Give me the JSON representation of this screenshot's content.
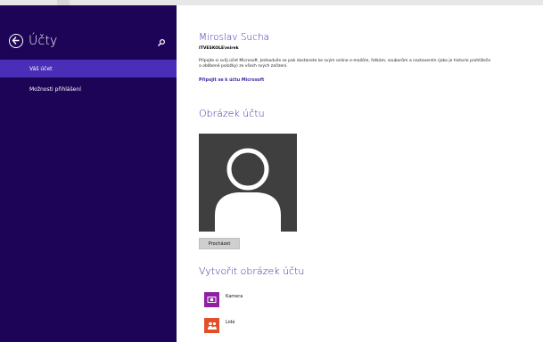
{
  "window": {
    "title": "Účty"
  },
  "sidebar": {
    "items": [
      {
        "label": "Váš účet",
        "selected": true
      },
      {
        "label": "Možnosti přihlášení",
        "selected": false
      }
    ]
  },
  "account": {
    "name": "Miroslav Sucha",
    "username": "ITVESKOLE\\mirek",
    "description": "Připojte si svůj účet Microsoft. Jednoduše se pak dostanete ke svým online e-mailům, fotkám, souborům a nastavením (jako je historie prohlížeče a oblíbené položky) ze všech svých zařízení.",
    "link": "Připojit se k účtu Microsoft"
  },
  "picture": {
    "heading": "Obrázek účtu",
    "browse_label": "Procházet"
  },
  "create": {
    "heading": "Vytvořit obrázek účtu",
    "options": [
      {
        "label": "Kamera",
        "icon": "camera-icon",
        "color": "#8f1fa3"
      },
      {
        "label": "Lidé",
        "icon": "people-icon",
        "color": "#e2502a"
      }
    ]
  },
  "colors": {
    "sidebar_bg": "#1d0457",
    "accent": "#4b2eb7",
    "heading": "#3f1f9a"
  }
}
